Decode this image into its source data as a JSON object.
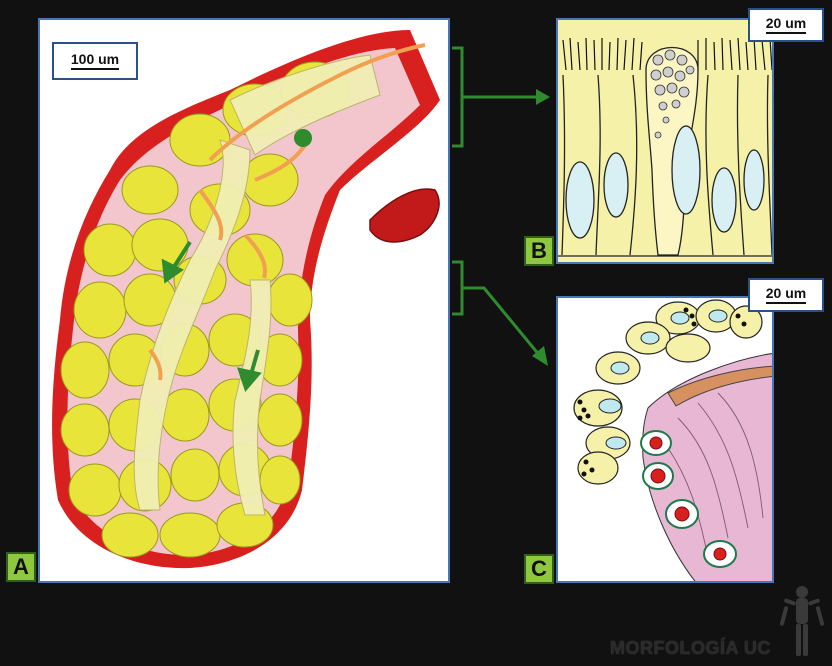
{
  "panels": {
    "a": {
      "label": "A",
      "scale": "100 um"
    },
    "b": {
      "label": "B",
      "scale": "20 um"
    },
    "c": {
      "label": "C",
      "scale": "20 um"
    }
  },
  "brand": "MORFOLOGÍA UC",
  "colors": {
    "frame": "#4a76b8",
    "label_bg": "#8fc73e",
    "arrow": "#2e8b2e",
    "acinus": "#e8e43a",
    "stroma": "#d8201e",
    "duct": "#f0a050",
    "cell": "#f6f1a8",
    "vacuole": "#d8f0f4",
    "connective": "#e7b7d3"
  }
}
